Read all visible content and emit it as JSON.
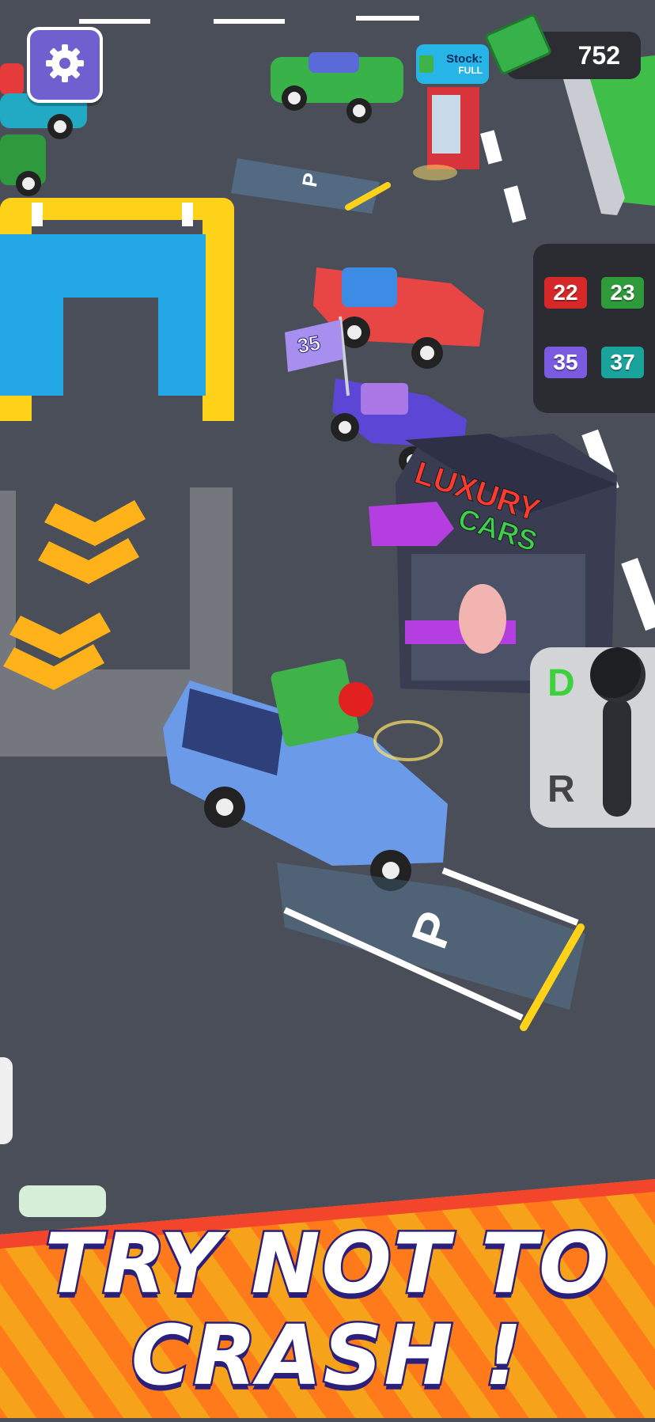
{
  "hud": {
    "money": "752",
    "stock_label": "Stock:",
    "stock_status": "FULL",
    "settings_icon": "gear-icon"
  },
  "queue": {
    "tickets": [
      {
        "number": "22",
        "color": "#d62828"
      },
      {
        "number": "23",
        "color": "#2e9a3a"
      },
      {
        "number": "35",
        "color": "#7a5be0"
      },
      {
        "number": "37",
        "color": "#1aa39a"
      }
    ]
  },
  "scene": {
    "car_flag_number": "35",
    "booth_sign_line1": "LUXURY",
    "booth_sign_line2": "CARS",
    "parking_label": "P"
  },
  "gearshift": {
    "drive_label": "D",
    "reverse_label": "R",
    "selected": "D"
  },
  "banner": {
    "line1": "TRY NOT TO",
    "line2": "CRASH !"
  },
  "colors": {
    "accent_purple": "#6f5fcf",
    "asphalt": "#4a4e58",
    "banner_orange": "#ff7a1a",
    "banner_red": "#f2452b",
    "text_outline": "#2a1f7a"
  }
}
